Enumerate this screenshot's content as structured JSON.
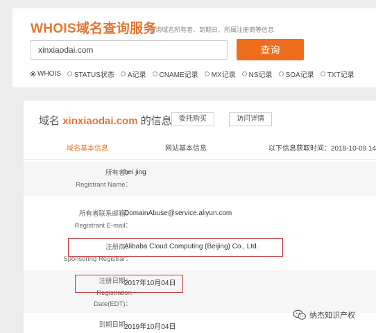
{
  "header": {
    "brand": "WHOIS域名查询服务",
    "tagline": "查询域名所有者、到期日、所属注册商等信息",
    "search_value": "xinxiaodai.com",
    "search_button": "查询",
    "radio_options": [
      "WHOIS",
      "STATUS状态",
      "A记录",
      "CNAME记录",
      "MX记录",
      "NS记录",
      "SOA记录",
      "TXT记录"
    ],
    "selected_option": "WHOIS"
  },
  "info": {
    "heading_prefix": "域名",
    "heading_domain": "xinxiaodai.com",
    "heading_suffix": "的信息",
    "buy_button": "委托购买",
    "visit_button": "访问详情",
    "tabs": [
      "域名基本信息",
      "网站基本信息"
    ],
    "active_tab": "域名基本信息",
    "fetch_time": "以下信息获取时间：2018-10-09 14"
  },
  "records": [
    {
      "label_cn": "所有者：",
      "label_en": "Registrant Name：",
      "value": "bei jing"
    },
    {
      "label_cn": "所有者联系邮箱：",
      "label_en": "Registrant E-mail：",
      "value": "DomainAbuse@service.aliyun.com"
    },
    {
      "label_cn": "注册商：",
      "label_en": "Sponsoring Registrar：",
      "value": "Alibaba Cloud Computing (Beijing) Co., Ltd."
    },
    {
      "label_cn": "注册日期：",
      "label_en": "Registration Date(EDT)：",
      "label_en_1": "Registration",
      "label_en_2": "Date(EDT)：",
      "value": "2017年10月04日"
    },
    {
      "label_cn": "到期日期：",
      "value": "2019年10月04日"
    }
  ],
  "watermark": {
    "icon": "wechat-icon",
    "text": "纳杰知识产权"
  },
  "colors": {
    "accent": "#e8742e",
    "button": "#ee6e1e",
    "highlight_box": "#c23a3a"
  }
}
